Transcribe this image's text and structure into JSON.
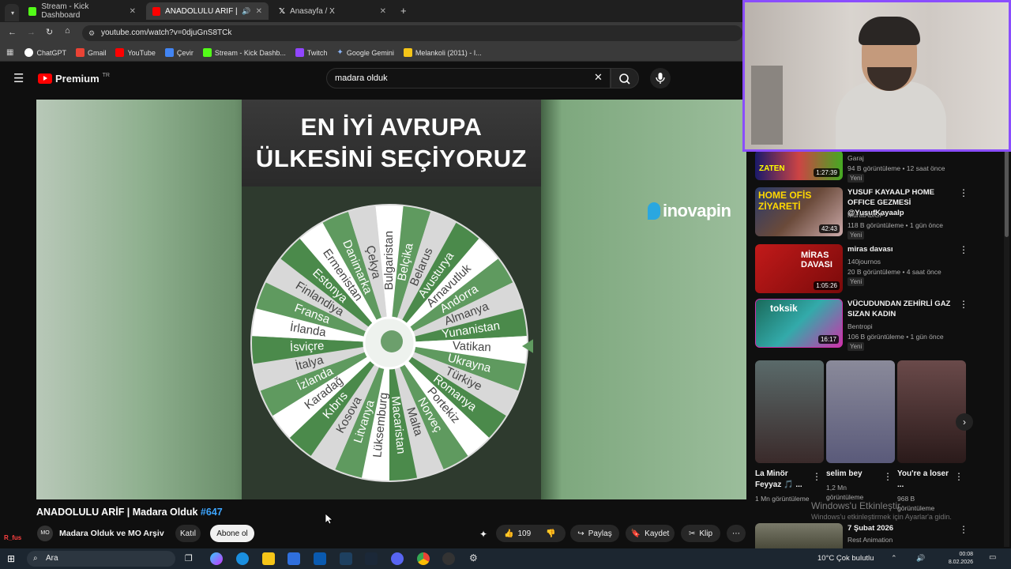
{
  "browser": {
    "tabs": [
      {
        "title": "Stream - Kick Dashboard",
        "color": "#53fc18"
      },
      {
        "title": "ANADOLULU ARİF | Madara",
        "color": "#ff0000"
      },
      {
        "title": "Anasayfa / X",
        "color": "#ffffff"
      }
    ],
    "url": "youtube.com/watch?v=0djuGnS8TCk",
    "bookmarks": [
      {
        "label": "ChatGPT",
        "color": "#ffffff"
      },
      {
        "label": "Gmail",
        "color": "#ea4335"
      },
      {
        "label": "YouTube",
        "color": "#ff0000"
      },
      {
        "label": "Çevir",
        "color": "#4285f4"
      },
      {
        "label": "Stream - Kick Dashb...",
        "color": "#53fc18"
      },
      {
        "label": "Twitch",
        "color": "#9146ff"
      },
      {
        "label": "Google Gemini",
        "color": "#8ab4f8"
      },
      {
        "label": "Melankoli (2011) - I...",
        "color": "#f5c518"
      }
    ]
  },
  "youtube": {
    "logo_label": "Premium",
    "logo_sup": "TR",
    "search_value": "madara olduk"
  },
  "video": {
    "overlay_line1": "EN İYİ AVRUPA",
    "overlay_line2": "ÜLKESİNİ SEÇİYORUZ",
    "sponsor": "inovapin",
    "wheel_labels": [
      "Bulgaristan",
      "Belçika",
      "Belarus",
      "Avusturya",
      "Arnavutluk",
      "Andorra",
      "Almanya",
      "Yunanistan",
      "Vatikan",
      "Ukrayna",
      "Türkiye",
      "Romanya",
      "Portekiz",
      "Norveç",
      "Malta",
      "Macaristan",
      "Lüksemburg",
      "Litvanya",
      "Kosova",
      "Kıbrıs",
      "Karadağ",
      "İzlanda",
      "İtalya",
      "İsviçre",
      "İrlanda",
      "Fransa",
      "Finlandiya",
      "Estonya",
      "Ermenistan",
      "Danimarka",
      "Çekya"
    ],
    "title": "ANADOLULU ARİF | Madara Olduk",
    "title_tag": "#647",
    "channel": "Madara Olduk ve MO Arşiv",
    "join_label": "Katıl",
    "subscribe_label": "Abone ol",
    "likes": "109",
    "share_label": "Paylaş",
    "save_label": "Kaydet",
    "clip_label": "Klip"
  },
  "recommended": [
    {
      "title": "",
      "channel": "Garaj",
      "meta": "94 B görüntüleme • 12 saat önce",
      "badge": "Yeni",
      "duration": "1:27:39"
    },
    {
      "title": "YUSUF KAYAALP HOME OFFICE GEZMESİ @YusufKayaalp",
      "channel": "MuratAbiGF",
      "meta": "118 B görüntüleme • 1 gün önce",
      "badge": "Yeni",
      "duration": "42:43"
    },
    {
      "title": "miras davası",
      "channel": "140journos",
      "meta": "20 B görüntüleme • 4 saat önce",
      "badge": "Yeni",
      "duration": "1:05:26"
    },
    {
      "title": "VÜCUDUNDAN ZEHİRLİ GAZ SIZAN KADIN",
      "channel": "Bentropi",
      "meta": "106 B görüntüleme • 1 gün önce",
      "badge": "Yeni",
      "duration": "16:17"
    }
  ],
  "shorts": [
    {
      "title": "La Minör Feyyaz 🎵 ...",
      "meta": "1 Mn görüntüleme"
    },
    {
      "title": "selim bey",
      "meta": "1,2 Mn görüntüleme"
    },
    {
      "title": "You're a loser ...",
      "meta": "968 B görüntüleme"
    }
  ],
  "last_rec": {
    "title": "7 Şubat 2026",
    "channel": "Rest Animation"
  },
  "thumb_texts": [
    "ZATEN",
    "HOME OFİS ZİYARETİ",
    "MİRAS DAVASI",
    "toksik"
  ],
  "watermark": {
    "line1": "Windows'u Etkinleştir",
    "line2": "Windows'u etkinleştirmek için Ayarlar'a gidin."
  },
  "taskbar": {
    "search_label": "Ara",
    "weather": "10°C  Çok bulutlu",
    "time": "00:08",
    "date": "8.02.2026"
  },
  "overlay_text": "R_fus"
}
